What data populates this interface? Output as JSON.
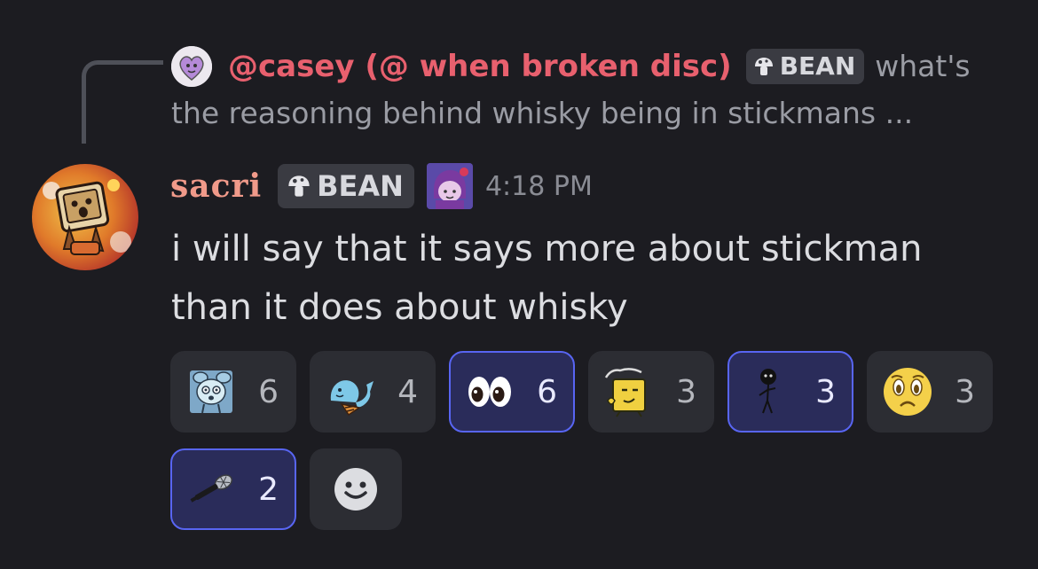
{
  "reply": {
    "author": "@casey (@ when broken disc)",
    "role_tag": "BEAN",
    "text_start": "what's",
    "text_continued": "the reasoning behind whisky being in stickmans ..."
  },
  "message": {
    "author": "sacri",
    "role_tag": "BEAN",
    "timestamp": "4:18 PM",
    "text": "i will say that it says more about stickman than it does about whisky"
  },
  "reactions": [
    {
      "emoji": "blue-creature-emoji",
      "count": "6",
      "me": false
    },
    {
      "emoji": "shrimp-emoji",
      "count": "4",
      "me": false
    },
    {
      "emoji": "eyes-emoji",
      "count": "6",
      "me": true
    },
    {
      "emoji": "hmm-block-emoji",
      "count": "3",
      "me": false
    },
    {
      "emoji": "stickman-emoji",
      "count": "3",
      "me": true
    },
    {
      "emoji": "pleading-face-emoji",
      "count": "3",
      "me": false
    },
    {
      "emoji": "microphone-emoji",
      "count": "2",
      "me": true
    }
  ],
  "add_reaction": {
    "icon": "smiley-face-icon"
  },
  "colors": {
    "background": "#1c1c21",
    "reply_author": "#e8606e",
    "username": "#f09a8a",
    "reaction_active_border": "#5865f2"
  }
}
